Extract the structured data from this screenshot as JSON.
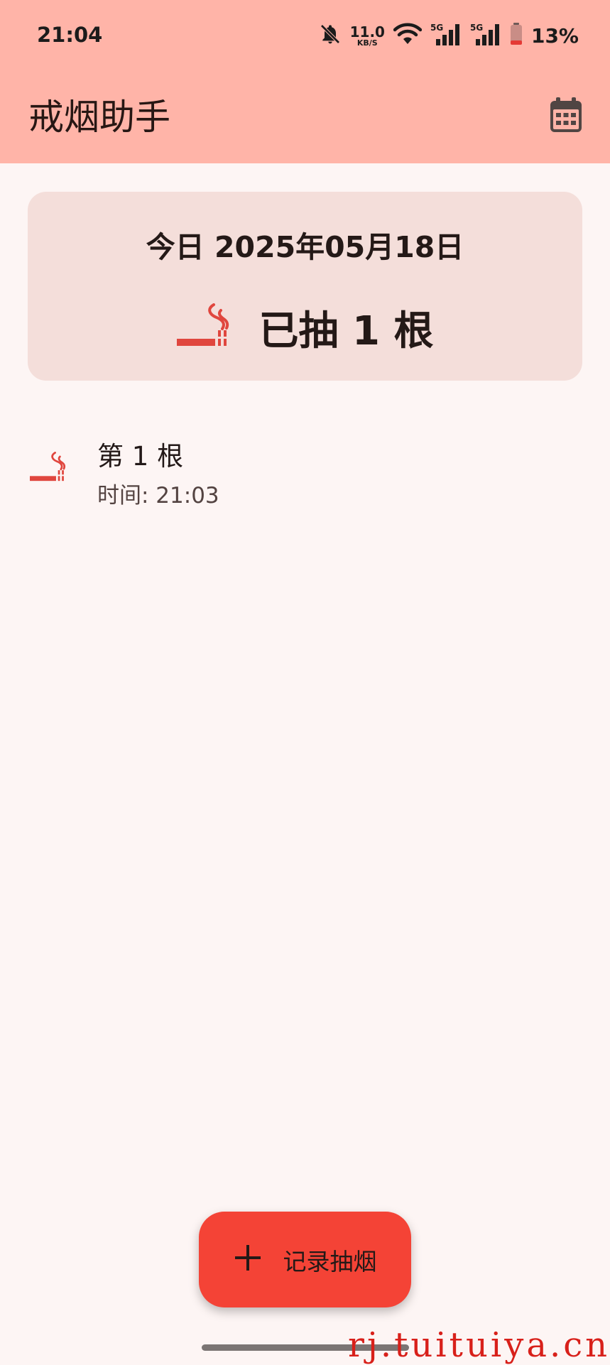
{
  "status_bar": {
    "time": "21:04",
    "net_speed_value": "11.0",
    "net_speed_unit": "KB/S",
    "signal_1_label": "5G",
    "signal_2_label": "5G",
    "battery": "13%"
  },
  "app_bar": {
    "title": "戒烟助手",
    "calendar_icon": "calendar-icon"
  },
  "summary": {
    "date": "今日 2025年05月18日",
    "count": "已抽 1 根",
    "icon": "smoking-icon"
  },
  "records": [
    {
      "title": "第 1 根",
      "time": "时间: 21:03",
      "icon": "smoking-icon"
    }
  ],
  "fab": {
    "label": "记录抽烟",
    "icon": "plus-icon"
  },
  "watermark": "rj.tuituiya.cn",
  "colors": {
    "top_bar": "#ffb4a8",
    "background": "#fdf5f4",
    "card": "#f4deda",
    "accent": "#f44336",
    "icon_red": "#e0463e"
  }
}
